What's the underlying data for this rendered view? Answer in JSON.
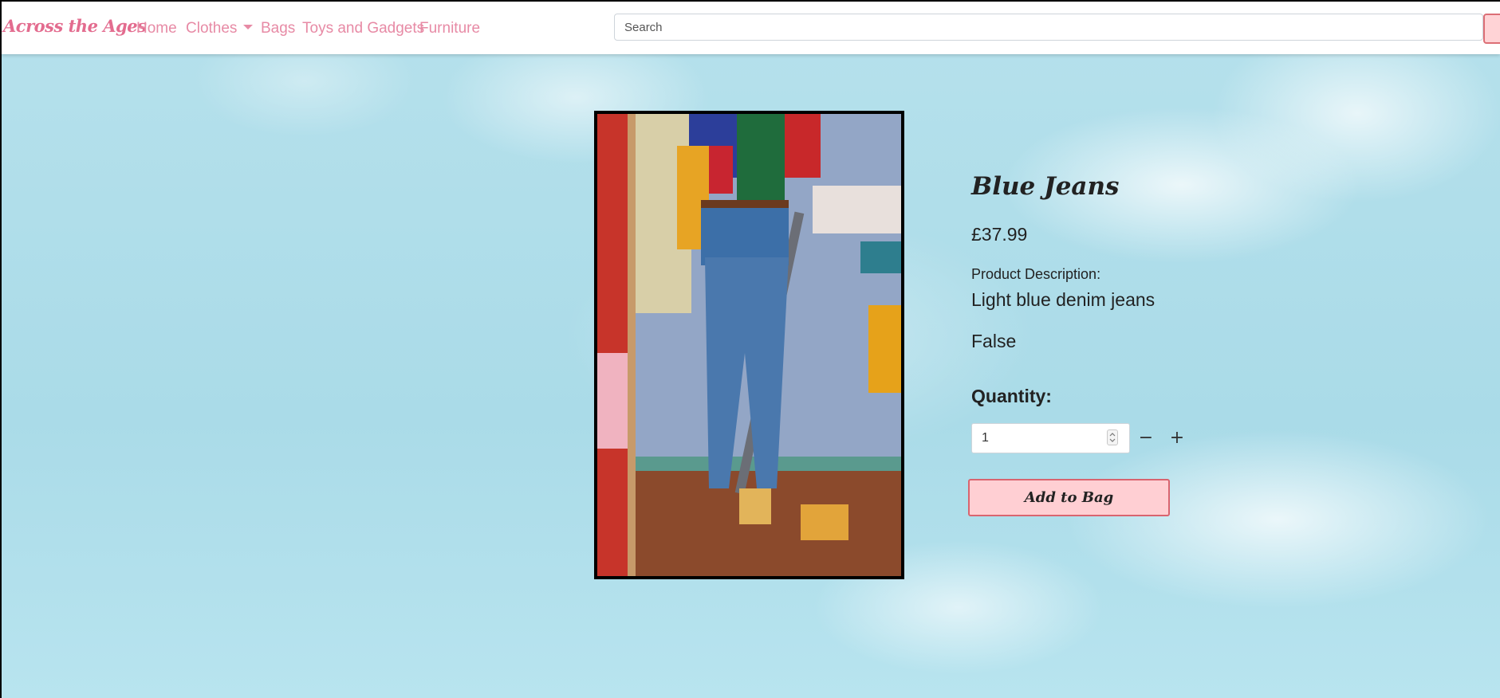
{
  "navbar": {
    "brand": "Across the Ages",
    "links": {
      "home": "Home",
      "clothes": "Clothes",
      "bags": "Bags",
      "toys": "Toys and Gadgets",
      "furniture": "Furniture"
    },
    "search_placeholder": "Search"
  },
  "product": {
    "title": "Blue Jeans",
    "price": "£37.99",
    "description_label": "Product Description:",
    "description": "Light blue denim jeans",
    "flag_text": "False",
    "quantity_label": "Quantity:",
    "quantity_value": "1",
    "decrement_symbol": "−",
    "increment_symbol": "+",
    "add_button": "Add to Bag"
  },
  "colors": {
    "brand": "#e36c8f",
    "nav_link": "#e78aa5",
    "button_bg": "#ffcfd3",
    "button_border": "#d9646f",
    "sky": "#aadbe8"
  }
}
